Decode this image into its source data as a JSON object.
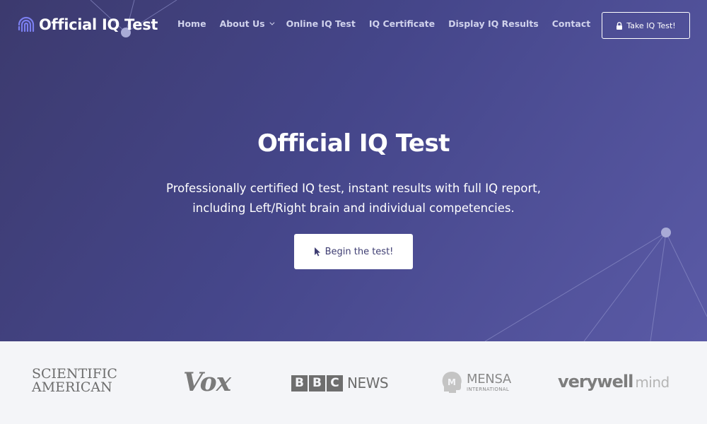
{
  "brand": {
    "name": "Official IQ Test",
    "logo_icon": "fingerprint-icon"
  },
  "nav": {
    "items": [
      {
        "label": "Home"
      },
      {
        "label": "About Us",
        "has_dropdown": true
      },
      {
        "label": "Online IQ Test"
      },
      {
        "label": "IQ Certificate"
      },
      {
        "label": "Display IQ Results"
      },
      {
        "label": "Contact"
      }
    ],
    "cta_label": "Take IQ Test!",
    "cta_icon": "lock-icon"
  },
  "hero": {
    "title": "Official IQ Test",
    "subtitle_line1": "Professionally certified IQ test, instant results with full IQ report,",
    "subtitle_line2": "including Left/Right brain and individual competencies.",
    "button_label": "Begin the test!",
    "button_icon": "cursor-icon"
  },
  "press_logos": {
    "scientific_american": {
      "line1": "SCIENTIFIC",
      "line2": "AMERICAN"
    },
    "vox": "Vox",
    "bbc_news": {
      "letters": [
        "B",
        "B",
        "C"
      ],
      "word": "NEWS"
    },
    "mensa": {
      "name": "MENSA",
      "subtitle": "INTERNATIONAL"
    },
    "verywell_mind": {
      "main": "verywell",
      "suffix": "mind"
    }
  },
  "colors": {
    "hero_gradient_start": "#3c3a6e",
    "hero_gradient_end": "#5a5aa6",
    "logo_strip_bg": "#f4f5f8",
    "accent_icon": "#7b7ff0",
    "button_text": "#3e3d72"
  }
}
